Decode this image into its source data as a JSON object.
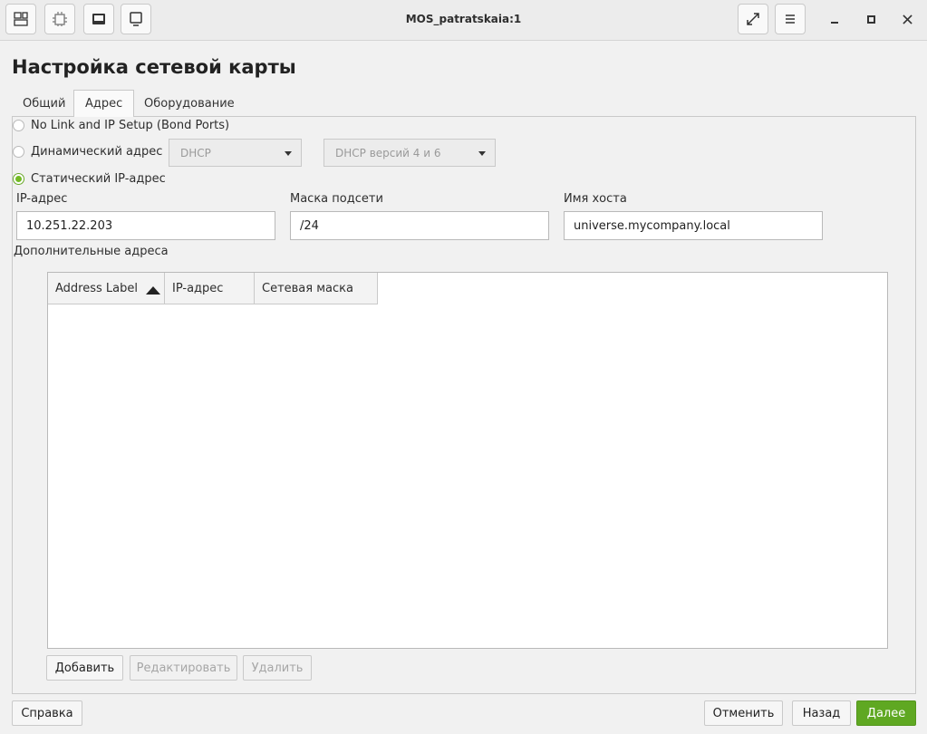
{
  "window": {
    "title": "MOS_patratskaia:1"
  },
  "header": {
    "title": "Настройка сетевой карты"
  },
  "tabs": [
    {
      "label": "Общий",
      "active": false
    },
    {
      "label": "Адрес",
      "active": true
    },
    {
      "label": "Оборудование",
      "active": false
    }
  ],
  "address_mode": {
    "options": [
      {
        "label": "No Link and IP Setup (Bond Ports)",
        "checked": false
      },
      {
        "label": "Динамический адрес",
        "checked": false
      },
      {
        "label": "Статический IP-адрес",
        "checked": true
      }
    ],
    "dhcp_combo": "DHCP",
    "dhcp_version_combo": "DHCP версий 4 и 6"
  },
  "static": {
    "ip_label": "IP-адрес",
    "ip_value": "10.251.22.203",
    "mask_label": "Маска подсети",
    "mask_value": "/24",
    "hostname_label": "Имя хоста",
    "hostname_value": "universe.mycompany.local"
  },
  "additional": {
    "label": "Дополнительные адреса",
    "columns": [
      "Address Label",
      "IP-адрес",
      "Сетевая маска"
    ],
    "rows": [],
    "add_button": "Добавить",
    "edit_button": "Редактировать",
    "delete_button": "Удалить"
  },
  "footer": {
    "help_button": "Справка",
    "cancel_button": "Отменить",
    "back_button": "Назад",
    "next_button": "Далее"
  },
  "colors": {
    "accent": "#73ba25",
    "primary_button": "#5fa822"
  }
}
